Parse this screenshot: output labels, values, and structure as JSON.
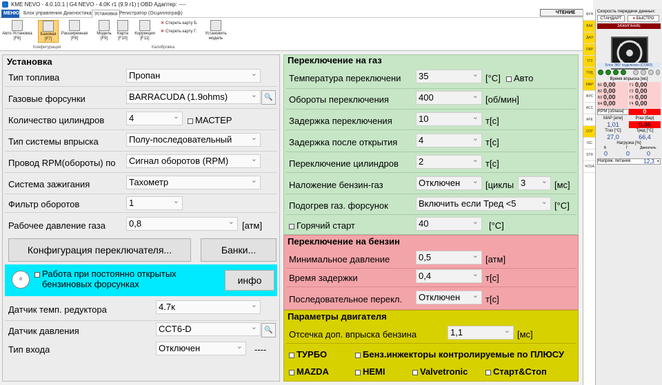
{
  "window": {
    "title": "KME NEVO - 4.0.10.1 | G4 NEVO - 4.0K r1 (9.9 r1) | OBD Адаптер: ----"
  },
  "tabs": {
    "menu": "МЕНЮ",
    "t1": "Блок управления",
    "t2": "Диагностика",
    "t3": "Установка",
    "t4": "Регистратор (Осциллограф)",
    "read": "ЧТЕНИЕ"
  },
  "ribbon": {
    "b1": "Авто-Установка [F6]",
    "b2": "Базовая [F7]",
    "b3": "Расширенная [F8]",
    "b4": "Модель [F9]",
    "b5": "Карта [F10]",
    "b6": "Коррекция [F11]",
    "d1": "Стереть карту Б.",
    "d2": "Стереть карту Г.",
    "b7": "Установить модель",
    "g1": "Конфигурация",
    "g2": "Калибровка"
  },
  "setup": {
    "title": "Установка",
    "fuel_type_label": "Тип топлива",
    "fuel_type": "Пропан",
    "injectors_label": "Газовые форсунки",
    "injectors": "BARRACUDA (1.9ohms)",
    "cyl_label": "Количество цилиндров",
    "cyl": "4",
    "master": "МАСТЕР",
    "inj_sys_label": "Тип системы впрыска",
    "inj_sys": "Полу-последовательный",
    "rpm_wire_label": "Провод RPM(обороты) по",
    "rpm_wire": "Сигнал оборотов (RPM)",
    "ign_label": "Система зажигания",
    "ign": "Тахометр",
    "rpm_filter_label": "Фильтр оборотов",
    "rpm_filter": "1",
    "work_press_label": "Рабочее давление газа",
    "work_press": "0,8",
    "atm": "[атм]",
    "config_btn": "Конфигурация переключателя...",
    "banks_btn": "Банки...",
    "open_inj_line1": "Работа при постоянно открытых",
    "open_inj_line2": "бензиновых форсунках",
    "info_btn": "инфо",
    "red_temp_label": "Датчик темп. редуктора",
    "red_temp": "4.7к",
    "press_sensor_label": "Датчик давления",
    "press_sensor": "CCT6-D",
    "input_type_label": "Тип входа",
    "input_type": "Отключен",
    "dashes": "----"
  },
  "gas_switch": {
    "title": "Переключение на газ",
    "temp_label": "Температура переключени",
    "temp": "35",
    "temp_unit": "[°C]",
    "auto": "Авто",
    "rpm_label": "Обороты переключения",
    "rpm": "400",
    "rpm_unit": "[об/мин]",
    "delay_label": "Задержка переключения",
    "delay": "10",
    "delay_unit": "т[с]",
    "delay_open_label": "Задержка после открытия",
    "delay_open": "4",
    "delay_open_unit": "т[с]",
    "cyl_switch_label": "Переключение цилиндров",
    "cyl_switch": "2",
    "cyl_switch_unit": "т[с]",
    "overlap_label": "Наложение бензин-газ",
    "overlap": "Отключен",
    "cycles": "[циклы",
    "cycles_val": "3",
    "ms": "[мс]",
    "heat_label": "Подогрев газ. форсунок",
    "heat": "Включить если Тред <5",
    "heat_unit": "[°C]",
    "hot_start_label": "Горячий старт",
    "hot_start": "40",
    "hot_start_unit": "[°C]"
  },
  "petrol_switch": {
    "title": "Переключение на бензин",
    "min_press_label": "Минимальное давление",
    "min_press": "0,5",
    "min_press_unit": "[атм]",
    "delay_label": "Время задержки",
    "delay": "0,4",
    "delay_unit": "т[с]",
    "seq_label": "Последовательное перекл.",
    "seq": "Отключен",
    "seq_unit": "т[с]"
  },
  "engine": {
    "title": "Параметры двигателя",
    "cutoff_label": "Отсечка доп. впрыска бензина",
    "cutoff": "1,1",
    "cutoff_unit": "[мс]",
    "turbo": "ТУРБО",
    "plus": "Бенз.инжекторы контролируемые по ПЛЮСУ",
    "mazda": "MAZDA",
    "hemi": "HEMI",
    "valvetronic": "Valvetronic",
    "startstop": "Старт&Стоп"
  },
  "vstrip": [
    "ФУН",
    "ВАК",
    "ДАЛ",
    "ОБР",
    "ТГЗ",
    "ТРД",
    "МАР",
    "ФРС",
    "АСС",
    "АРЕ",
    "СОГ",
    "ISC",
    "STR",
    "ЧОSA"
  ],
  "rpanel": {
    "speed_label": "Скорость передачи данных:",
    "std": "СТАНДАРТ",
    "fast": "БЫСТРО",
    "ignition": "ЗАЖИГАНИЕ",
    "ecu_status": "Блок ЭБУ подключен (COM3)",
    "inj_time": "Время впрыска [мс]",
    "b1": "Б1",
    "b2": "Б2",
    "b3": "Б3",
    "b4": "Б4",
    "g1": "Г1",
    "g2": "Г2",
    "g3": "Г3",
    "g4": "Г4",
    "b1v": "0,00",
    "b2v": "0,00",
    "b3v": "0,00",
    "b4v": "0,00",
    "g1v": "0,00",
    "g2v": "0,00",
    "g3v": "0,00",
    "g4v": "0,00",
    "rpm_label": "RPM [об/мин]",
    "rpm": "0",
    "map_label": "MAP [атм]",
    "map": "1,01",
    "pgas_label": "Pгаз [бар]",
    "pgas": "0,46",
    "tgas_label": "Тгаз [°C]",
    "tgas": "27,0",
    "tred_label": "Тред [°C]",
    "tred": "66,4",
    "load_label": "Нагрузка [%]",
    "lb": "Б",
    "lg": "Г",
    "leng": "Двигатель",
    "lbv": "0",
    "lgv": "0",
    "lengv": "0",
    "voltage_label": "Напряж. питания",
    "voltage": "12,3"
  }
}
